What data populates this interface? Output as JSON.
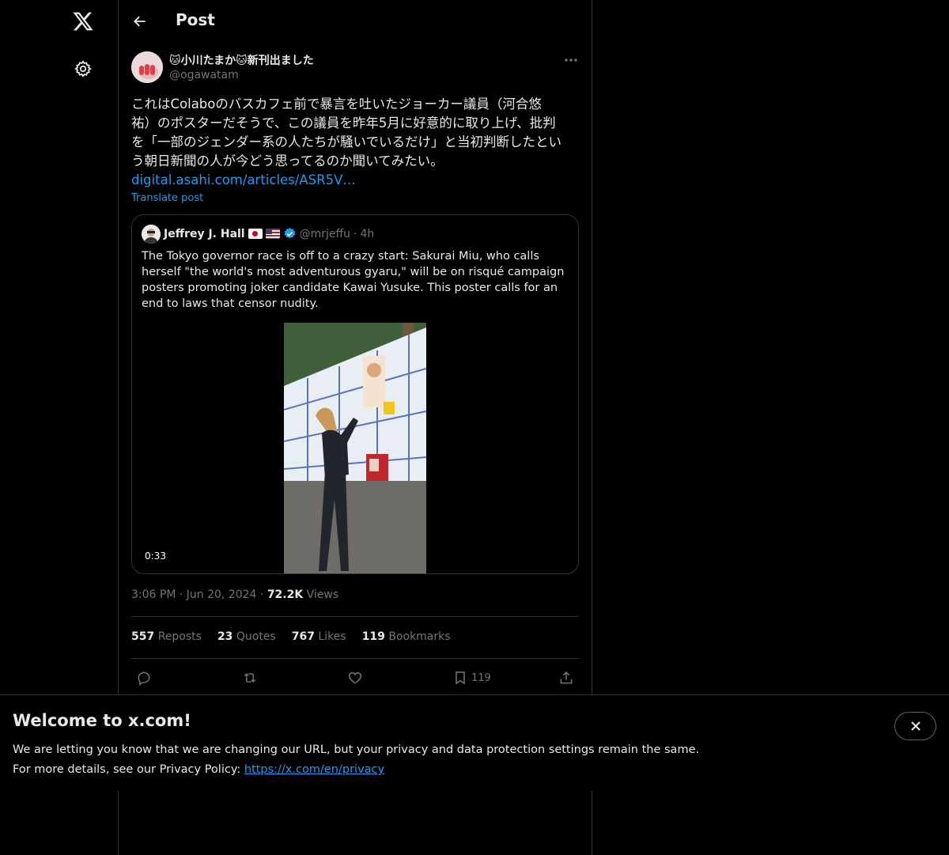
{
  "header": {
    "title": "Post"
  },
  "post": {
    "author_name": "🐱小川たまか🐱新刊出ました",
    "author_handle": "@ogawatam",
    "text_lines": [
      "これはColaboのバスカフェ前で暴言を吐いたジョーカー議員（河合悠",
      "祐）のポスターだそうで、この議員を昨年5月に好意的に取り上げ、批判",
      "を「一部のジェンダー系の人たちが騒いでいるだけ」と当初判断したとい",
      "う朝日新聞の人が今どう思ってるのか聞いてみたい。"
    ],
    "link": "digital.asahi.com/articles/ASR5V…",
    "translate": "Translate post",
    "time": "3:06 PM",
    "date": "Jun 20, 2024",
    "views_count": "72.2K",
    "views_label": "Views"
  },
  "quote": {
    "name": "Jeffrey J. Hall",
    "handle": "@mrjeffu",
    "dot": "·",
    "time": "4h",
    "text": "The Tokyo governor race is off to a crazy start: Sakurai Miu, who calls herself \"the world's most adventurous gyaru,\" will be on risqué campaign posters promoting joker candidate Kawai Yusuke. This poster calls for an end to laws that censor nudity.",
    "video_duration": "0:33"
  },
  "stats": {
    "reposts_count": "557",
    "reposts_label": "Reposts",
    "quotes_count": "23",
    "quotes_label": "Quotes",
    "likes_count": "767",
    "likes_label": "Likes",
    "bookmarks_count": "119",
    "bookmarks_label": "Bookmarks"
  },
  "actions": {
    "bookmark_count": "119"
  },
  "banner": {
    "title": "Welcome to x.com!",
    "line1": "We are letting you know that we are changing our URL, but your privacy and data protection settings remain the same.",
    "line2_prefix": "For more details, see our Privacy Policy: ",
    "link": "https://x.com/en/privacy"
  },
  "icons": {
    "logo": "x-logo-icon",
    "settings": "gear-icon",
    "back": "arrow-left-icon",
    "more": "more-horizontal-icon",
    "reply": "reply-icon",
    "repost": "repost-icon",
    "like": "heart-icon",
    "bookmark": "bookmark-icon",
    "share": "share-icon",
    "verified": "verified-badge-icon",
    "close": "close-icon"
  },
  "colors": {
    "accent": "#1d9bf0",
    "background": "#000000",
    "text": "#e7e9ea",
    "muted": "#71767b",
    "border": "#2f3336"
  }
}
